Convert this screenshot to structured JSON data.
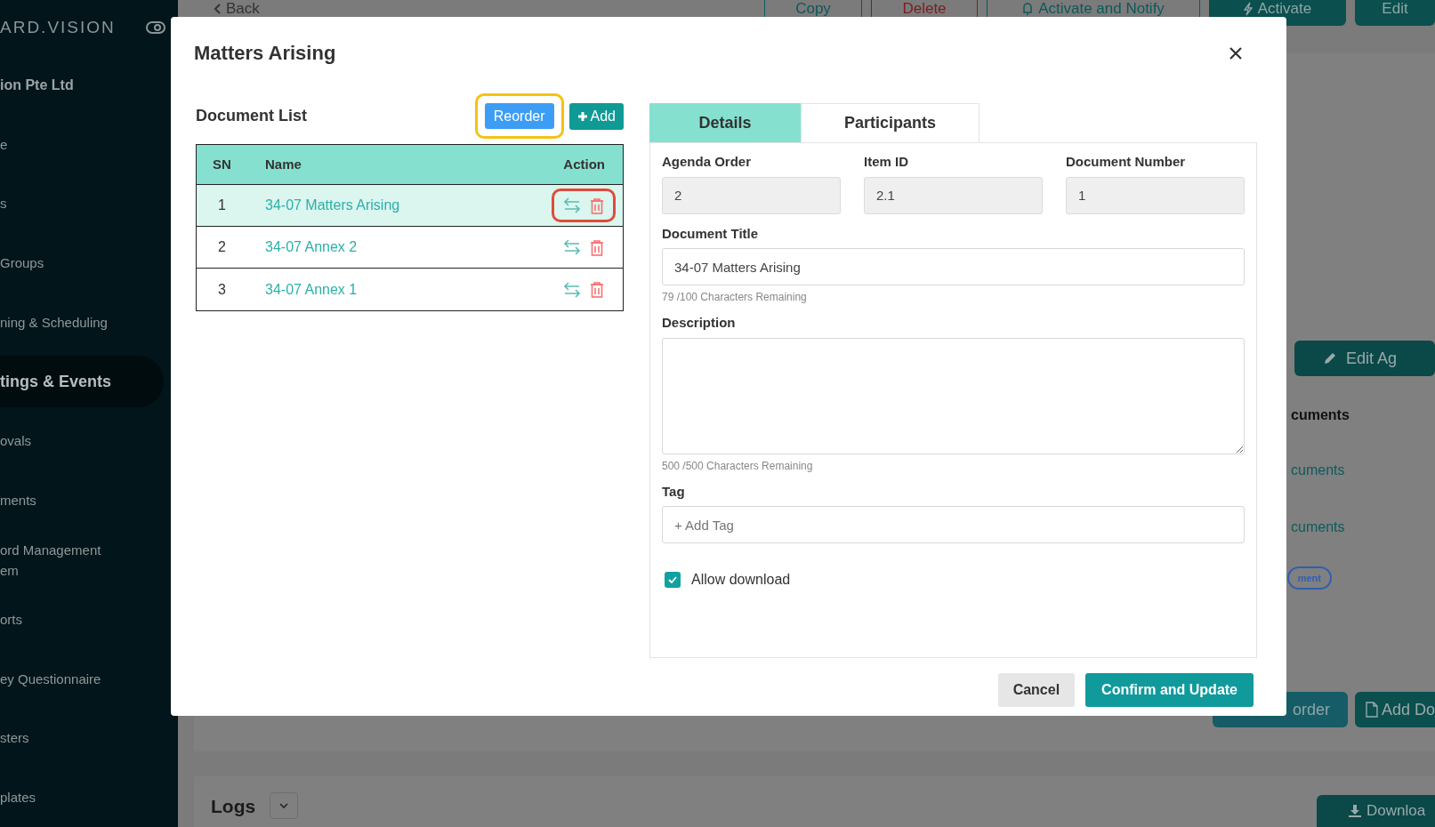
{
  "sidebar": {
    "brand": "ARD.VISION",
    "items": [
      {
        "label": "ion Pte Ltd",
        "selected": false,
        "kind": "org"
      },
      {
        "label": "e",
        "selected": false,
        "kind": "link"
      },
      {
        "label": "s",
        "selected": false,
        "kind": "link"
      },
      {
        "label": "Groups",
        "selected": false,
        "kind": "link"
      },
      {
        "label": "ning & Scheduling",
        "selected": false,
        "kind": "link"
      },
      {
        "label": "tings & Events",
        "selected": true,
        "kind": "link"
      },
      {
        "label": "ovals",
        "selected": false,
        "kind": "link"
      },
      {
        "label": "ments",
        "selected": false,
        "kind": "link"
      },
      {
        "label": "ord Management\nem",
        "selected": false,
        "kind": "link"
      },
      {
        "label": "orts",
        "selected": false,
        "kind": "link"
      },
      {
        "label": "ey Questionnaire",
        "selected": false,
        "kind": "link"
      },
      {
        "label": "sters",
        "selected": false,
        "kind": "link"
      },
      {
        "label": "plates",
        "selected": false,
        "kind": "link"
      }
    ]
  },
  "topbar": {
    "back": "Back",
    "buttons": [
      {
        "label": "Copy",
        "kind": "outline"
      },
      {
        "label": "Delete",
        "kind": "danger"
      },
      {
        "label": "Activate and Notify",
        "kind": "outline_bell"
      },
      {
        "label": "Activate",
        "kind": "solid_bolt"
      },
      {
        "label": "Edit",
        "kind": "solid"
      }
    ]
  },
  "background": {
    "edit_button": "Edit Ag",
    "documents_header": "cuments",
    "document_links": [
      "cuments",
      "cuments"
    ],
    "badge": "ment",
    "reorder_button": "order",
    "add_button": "Add Do",
    "logs_title": "Logs",
    "download_button": "Downloa"
  },
  "dialog": {
    "title": "Matters Arising",
    "document_list": {
      "title": "Document List",
      "reorder_button": {
        "label": "Reorder",
        "highlighted": true
      },
      "add_button": "Add",
      "columns": [
        "SN",
        "Name",
        "Action"
      ],
      "rows": [
        {
          "sn": "1",
          "name": "34-07 Matters Arising",
          "selected": true,
          "highlighted": true
        },
        {
          "sn": "2",
          "name": "34-07 Annex 2",
          "selected": false,
          "highlighted": false
        },
        {
          "sn": "3",
          "name": "34-07 Annex 1",
          "selected": false,
          "highlighted": false
        }
      ]
    },
    "tabs": [
      {
        "label": "Details",
        "selected": true
      },
      {
        "label": "Participants",
        "selected": false
      }
    ],
    "fields": [
      {
        "label": "Agenda Order",
        "value": "2"
      },
      {
        "label": "Item ID",
        "value": "2.1"
      },
      {
        "label": "Document Number",
        "value": "1"
      }
    ],
    "document_title": {
      "label": "Document Title",
      "value": "34-07 Matters Arising",
      "counter": "79 /100 Characters Remaining"
    },
    "description": {
      "label": "Description",
      "counter": "500 /500 Characters Remaining"
    },
    "tag": {
      "label": "Tag",
      "placeholder": "+ Add Tag"
    },
    "allow_download": {
      "label": "Allow download",
      "checked": true
    },
    "cancel_button": "Cancel",
    "confirm_button": "Confirm and Update"
  }
}
